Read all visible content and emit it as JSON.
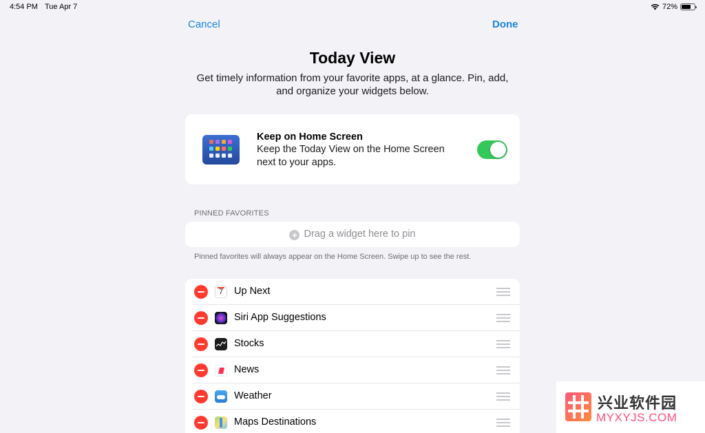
{
  "status_bar": {
    "time": "4:54 PM",
    "date": "Tue Apr 7",
    "battery": "72%",
    "battery_level": 0.72
  },
  "nav": {
    "cancel_label": "Cancel",
    "done_label": "Done"
  },
  "header": {
    "title": "Today View",
    "subtitle": "Get timely information from your favorite apps, at a glance. Pin, add, and organize your widgets below."
  },
  "keep_on_home": {
    "title": "Keep on Home Screen",
    "description": "Keep the Today View on the Home Screen next to your apps.",
    "enabled": true,
    "toggle_color": "#34c759"
  },
  "pinned": {
    "header": "PINNED FAVORITES",
    "drop_hint": "Drag a widget here to pin",
    "footer": "Pinned favorites will always appear on the Home Screen. Swipe up to see the rest."
  },
  "widgets": [
    {
      "label": "Up Next",
      "icon": "calendar-icon",
      "calendar_day": "7"
    },
    {
      "label": "Siri App Suggestions",
      "icon": "siri-icon"
    },
    {
      "label": "Stocks",
      "icon": "stocks-icon"
    },
    {
      "label": "News",
      "icon": "news-icon"
    },
    {
      "label": "Weather",
      "icon": "weather-icon"
    },
    {
      "label": "Maps Destinations",
      "icon": "maps-icon"
    }
  ],
  "watermark": {
    "title": "兴业软件园",
    "url": "MYXYJS.COM"
  },
  "colors": {
    "accent": "#1a82e2",
    "delete": "#ff3b30",
    "background": "#f2f2f7"
  }
}
